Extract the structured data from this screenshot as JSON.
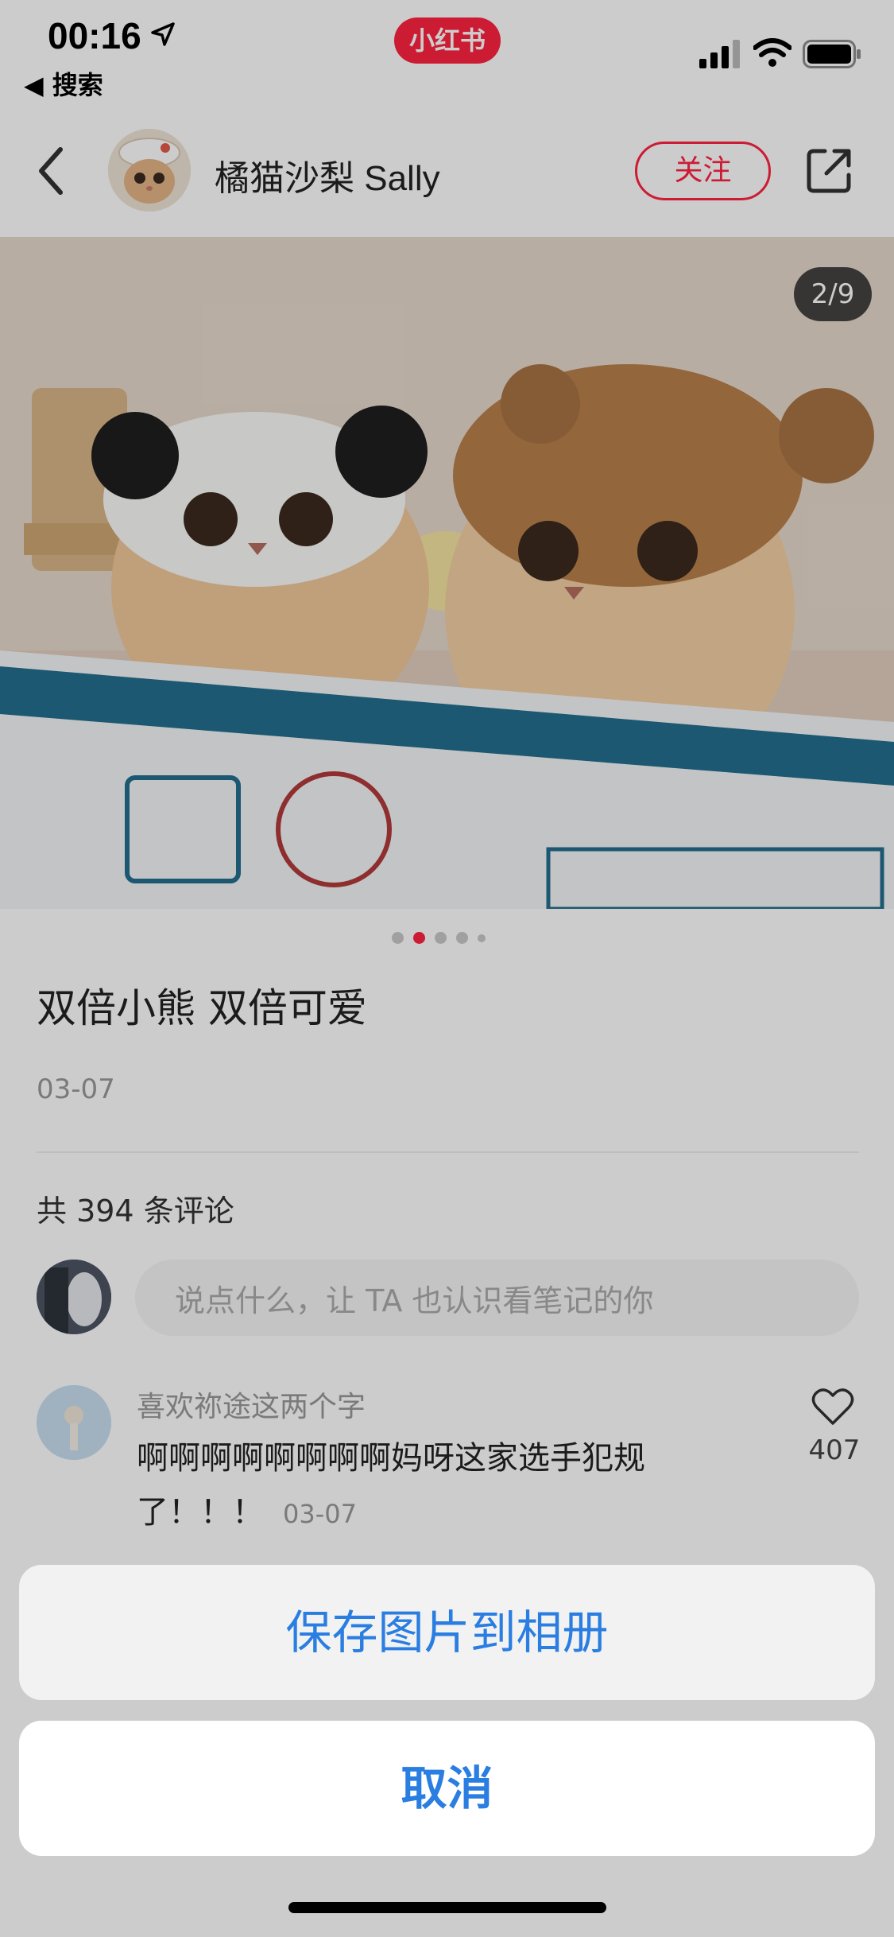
{
  "status_bar": {
    "time": "00:16",
    "back_label": "◀ 搜索",
    "app_badge": "小红书",
    "icons": [
      "location-arrow-icon",
      "signal-icon",
      "wifi-icon",
      "battery-icon"
    ]
  },
  "header": {
    "author_name": "橘猫沙梨 Sally",
    "follow_label": "关注",
    "icons": [
      "back-arrow-icon",
      "share-icon"
    ]
  },
  "image": {
    "counter": "2/9",
    "dots_count": 5,
    "active_dot": 1
  },
  "note": {
    "title": "双倍小熊 双倍可爱",
    "date": "03-07"
  },
  "comments": {
    "count_label": "共 394 条评论",
    "input_placeholder": "说点什么，让 TA 也认识看笔记的你",
    "items": [
      {
        "user": "喜欢祢途这两个字",
        "text": "啊啊啊啊啊啊啊啊妈呀这家选手犯规了！！！",
        "date": "03-07",
        "likes": "407"
      }
    ]
  },
  "action_sheet": {
    "save_label": "保存图片到相册",
    "cancel_label": "取消"
  },
  "colors": {
    "brand": "#ff2442",
    "action_blue": "#2a7de1"
  }
}
